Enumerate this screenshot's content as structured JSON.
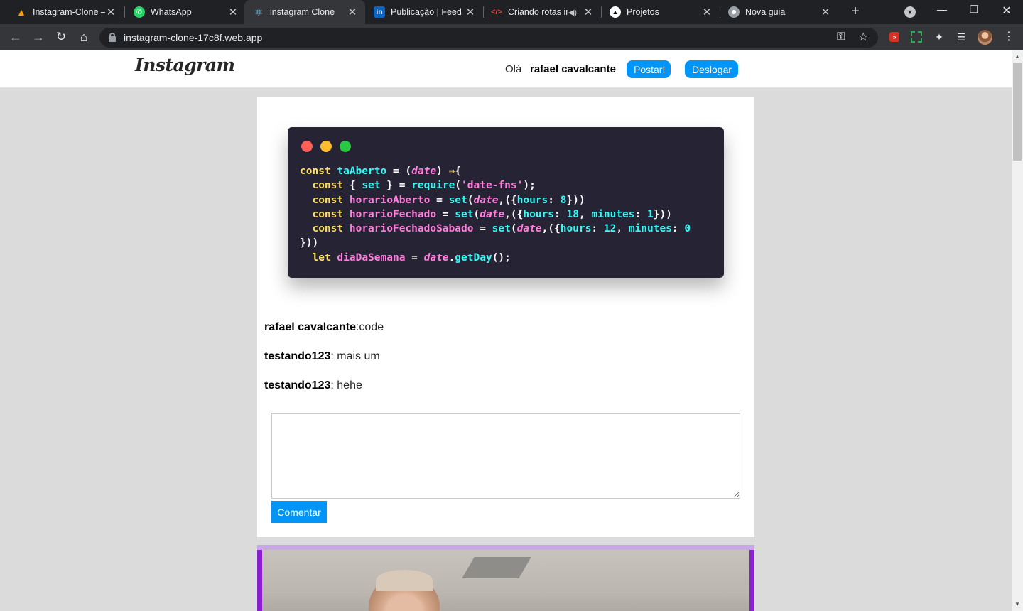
{
  "browser": {
    "tabs": [
      {
        "title": "Instagram-Clone – I",
        "icon": "firebase-icon",
        "active": false
      },
      {
        "title": "WhatsApp",
        "icon": "whatsapp-icon",
        "active": false
      },
      {
        "title": "instagram Clone",
        "icon": "react-icon",
        "active": true
      },
      {
        "title": "Publicação | Feed |",
        "icon": "linkedin-icon",
        "active": false
      },
      {
        "title": "Criando rotas in",
        "icon": "code-icon",
        "active": false
      },
      {
        "title": "Projetos",
        "icon": "triangle-icon",
        "active": false
      },
      {
        "title": "Nova guia",
        "icon": "chrome-icon",
        "active": false
      }
    ],
    "url": "instagram-clone-17c8f.web.app"
  },
  "header": {
    "logo": "Instagram",
    "greeting": "Olá",
    "username": "rafael cavalcante",
    "post_button": "Postar!",
    "logout_button": "Deslogar"
  },
  "post": {
    "code": [
      "const taAberto = (date) ⇒{",
      "  const { set } = require('date-fns');",
      "  const horarioAberto = set(date,({hours: 8}))",
      "  const horarioFechado = set(date,({hours: 18, minutes: 1}))",
      "  const horarioFechadoSabado = set(date,({hours: 12, minutes: 0",
      "}))",
      "  let diaDaSemana = date.getDay();"
    ],
    "comments": [
      {
        "user": "rafael cavalcante",
        "text": ":code"
      },
      {
        "user": "testando123",
        "text": ": mais um"
      },
      {
        "user": "testando123",
        "text": ": hehe"
      }
    ],
    "comment_placeholder": "",
    "comment_button": "Comentar"
  },
  "colors": {
    "accent": "#0095f6",
    "code_bg": "#262335",
    "dot_red": "#ff5f57",
    "dot_yellow": "#febc2e",
    "dot_green": "#28c840"
  }
}
